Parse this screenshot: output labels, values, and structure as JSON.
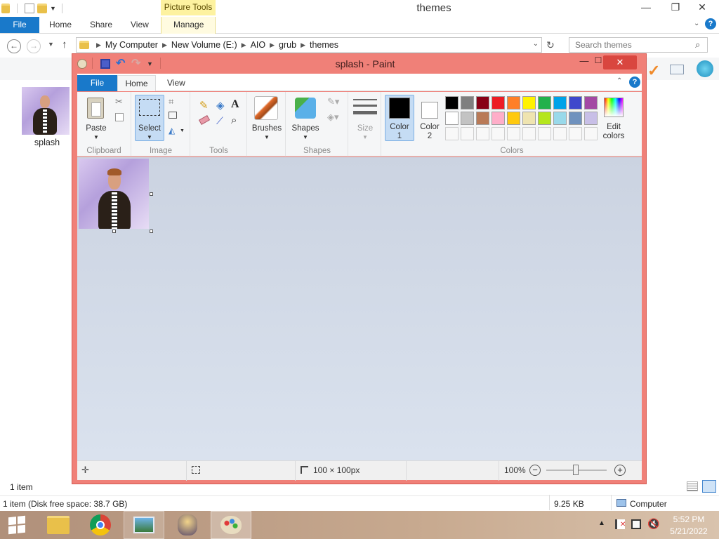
{
  "explorer": {
    "title": "themes",
    "picture_tools": "Picture Tools",
    "tabs": {
      "file": "File",
      "home": "Home",
      "share": "Share",
      "view": "View",
      "manage": "Manage"
    },
    "breadcrumb": [
      "My Computer",
      "New Volume (E:)",
      "AIO",
      "grub",
      "themes"
    ],
    "search_placeholder": "Search themes",
    "file_label": "splash",
    "item_count": "1 item",
    "status_left": "1 item (Disk free space: 38.7 GB)",
    "status_size": "9.25 KB",
    "status_location": "Computer"
  },
  "paint": {
    "title": "splash - Paint",
    "tabs": {
      "file": "File",
      "home": "Home",
      "view": "View"
    },
    "ribbon": {
      "paste": "Paste",
      "select": "Select",
      "brushes": "Brushes",
      "shapes": "Shapes",
      "size": "Size",
      "color1": "Color\n1",
      "color2": "Color\n2",
      "edit_colors": "Edit\ncolors",
      "groups": {
        "clipboard": "Clipboard",
        "image": "Image",
        "tools": "Tools",
        "shapes": "Shapes",
        "colors": "Colors"
      }
    },
    "palette_row1": [
      "#000000",
      "#7f7f7f",
      "#880015",
      "#ed1c24",
      "#ff7f27",
      "#fff200",
      "#22b14c",
      "#00a2e8",
      "#3f48cc",
      "#a349a4"
    ],
    "palette_row2": [
      "#ffffff",
      "#c3c3c3",
      "#b97a57",
      "#ffaec9",
      "#ffc90e",
      "#efe4b0",
      "#b5e61d",
      "#99d9ea",
      "#7092be",
      "#c8bfe7"
    ],
    "color1": "#000000",
    "color2": "#ffffff",
    "status": {
      "dimensions": "100 × 100px",
      "zoom": "100%"
    }
  },
  "taskbar": {
    "time": "5:52 PM",
    "date": "5/21/2022"
  },
  "colors": {
    "accent_blue": "#1979ca",
    "paint_frame": "#f08078",
    "close_red": "#d9463f"
  }
}
